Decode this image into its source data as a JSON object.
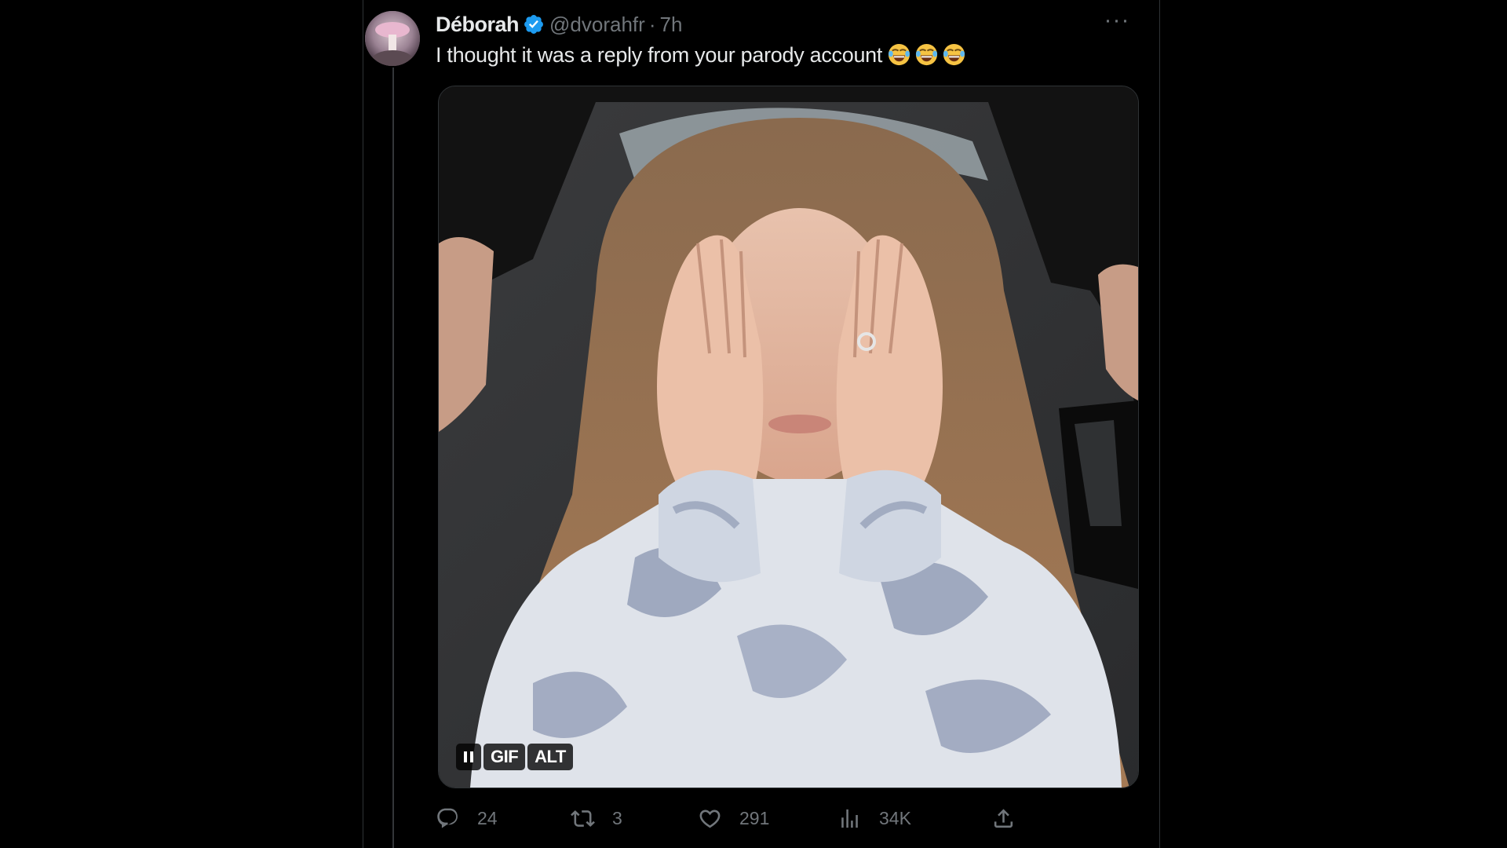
{
  "tweet": {
    "display_name": "Déborah",
    "handle": "@dvorahfr",
    "separator": "·",
    "time": "7h",
    "text": "I thought it was a reply from your parody account",
    "emojis": [
      "face-with-tears-of-joy",
      "face-with-tears-of-joy",
      "face-with-tears-of-joy"
    ],
    "more_label": "···"
  },
  "media": {
    "description_badges": [
      "GIF",
      "ALT"
    ],
    "gif_label": "GIF",
    "alt_label": "ALT"
  },
  "actions": {
    "replies": "24",
    "retweets": "3",
    "likes": "291",
    "views": "34K"
  },
  "colors": {
    "background": "#000000",
    "primary_text": "#e7e9ea",
    "secondary_text": "#71767b",
    "verified_blue": "#1d9bf0",
    "border": "#2f3336"
  },
  "icons": {
    "reply": "reply-icon",
    "retweet": "retweet-icon",
    "like": "heart-icon",
    "views": "analytics-icon",
    "share": "share-icon",
    "verified": "verified-badge-icon",
    "more": "more-icon",
    "pause": "pause-icon"
  }
}
